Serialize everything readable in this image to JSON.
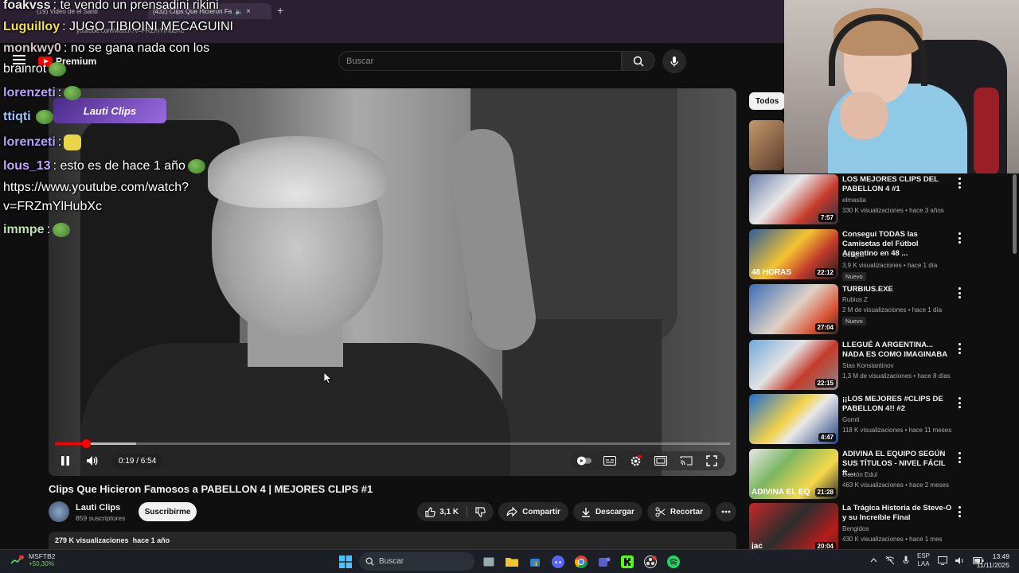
{
  "browser": {
    "tabs": [
      {
        "label": "(19) Video de el Santi"
      },
      {
        "label": "(432) Clips Que Hicieron Fa"
      }
    ],
    "new_tab": "+",
    "url": "youtube.com/watch?v=FRZmYlHubXc"
  },
  "header": {
    "logo_text": "Premium",
    "search_placeholder": "Buscar"
  },
  "player": {
    "channel_overlay": "Lauti Clips",
    "time": "0:19 / 6:54",
    "progress": 0.046
  },
  "video": {
    "title": "Clips Que Hicieron Famosos a PABELLON 4 | MEJORES CLIPS #1",
    "channel": "Lauti Clips",
    "subscribers": "859 suscriptores",
    "subscribe_label": "Suscribirme",
    "likes": "3,1 K",
    "share_label": "Compartir",
    "download_label": "Descargar",
    "clip_label": "Recortar",
    "views": "279 K visualizaciones",
    "age": "hace 1 año"
  },
  "sidebar": {
    "chip": "Todos",
    "items": [
      {
        "title": "LOS MEJORES CLIPS DEL PABELLON 4 #1",
        "channel": "elmasita",
        "meta": "330 K visualizaciones • hace 3 años",
        "duration": "7:57",
        "badge": "",
        "thumb_text": ""
      },
      {
        "title": "Conseguí TODAS las Camisetas del Fútbol Argentino en 48 ...",
        "channel": "Guaglia",
        "meta": "3,9 K visualizaciones • hace 1 día",
        "duration": "22:12",
        "badge": "Nuevo",
        "thumb_text": "48 HORAS"
      },
      {
        "title": "TURBIUS.EXE",
        "channel": "Rubius Z",
        "meta": "2 M de visualizaciones • hace 1 día",
        "duration": "27:04",
        "badge": "Nuevo",
        "thumb_text": ""
      },
      {
        "title": "LLEGUÉ A ARGENTINA... NADA ES COMO IMAGINABA",
        "channel": "Stas Konstantinov",
        "meta": "1,3 M de visualizaciones • hace 8 días",
        "duration": "22:15",
        "badge": "",
        "thumb_text": ""
      },
      {
        "title": "¡¡LOS MEJORES #CLIPS DE PABELLON 4!! #2",
        "channel": "Gomti",
        "meta": "118 K visualizaciones • hace 11 meses",
        "duration": "4:47",
        "badge": "",
        "thumb_text": ""
      },
      {
        "title": "ADIVINA EL EQUIPO SEGÚN SUS TÍTULOS - NIVEL FÁCIL ft....",
        "channel": "Gastón Edul",
        "meta": "463 K visualizaciones • hace 2 meses",
        "duration": "21:28",
        "badge": "",
        "thumb_text": "ADIVINA EL EQ"
      },
      {
        "title": "La Trágica Historia de Steve-O y su Increíble Final",
        "channel": "Bengidos",
        "meta": "430 K visualizaciones • hace 1 mes",
        "duration": "20:04",
        "badge": "",
        "thumb_text": "jac"
      }
    ]
  },
  "chat": [
    {
      "name": "foakvss",
      "msg": ": te vendo un prensadini rikini"
    },
    {
      "name": "Luguilloy",
      "msg": ": JUGO TIBIOINI MECAGUINI"
    },
    {
      "name": "monkwy0",
      "msg": ": no se gana nada con los"
    },
    {
      "name": "",
      "msg": "brainrot"
    },
    {
      "name": "lorenzeti",
      "msg": ":"
    },
    {
      "name": "ttiqti",
      "msg": ""
    },
    {
      "name": "lorenzeti",
      "msg": ":"
    },
    {
      "name": "lous_13",
      "msg": ": esto es de hace 1 año"
    },
    {
      "name": "",
      "msg": "https://www.youtube.com/watch?"
    },
    {
      "name": "",
      "msg": "v=FRZmYlHubXc"
    },
    {
      "name": "immpe",
      "msg": ":"
    }
  ],
  "taskbar": {
    "stock_name": "MSFTB2",
    "stock_change": "+50,30%",
    "search_placeholder": "Buscar",
    "lang_top": "ESP",
    "lang_bottom": "LAA",
    "time": "13:49",
    "date": "11/11/2025"
  },
  "colors": {
    "accent_red": "#ff0000",
    "bg": "#0f0f0f",
    "chip_bg": "#272727"
  }
}
